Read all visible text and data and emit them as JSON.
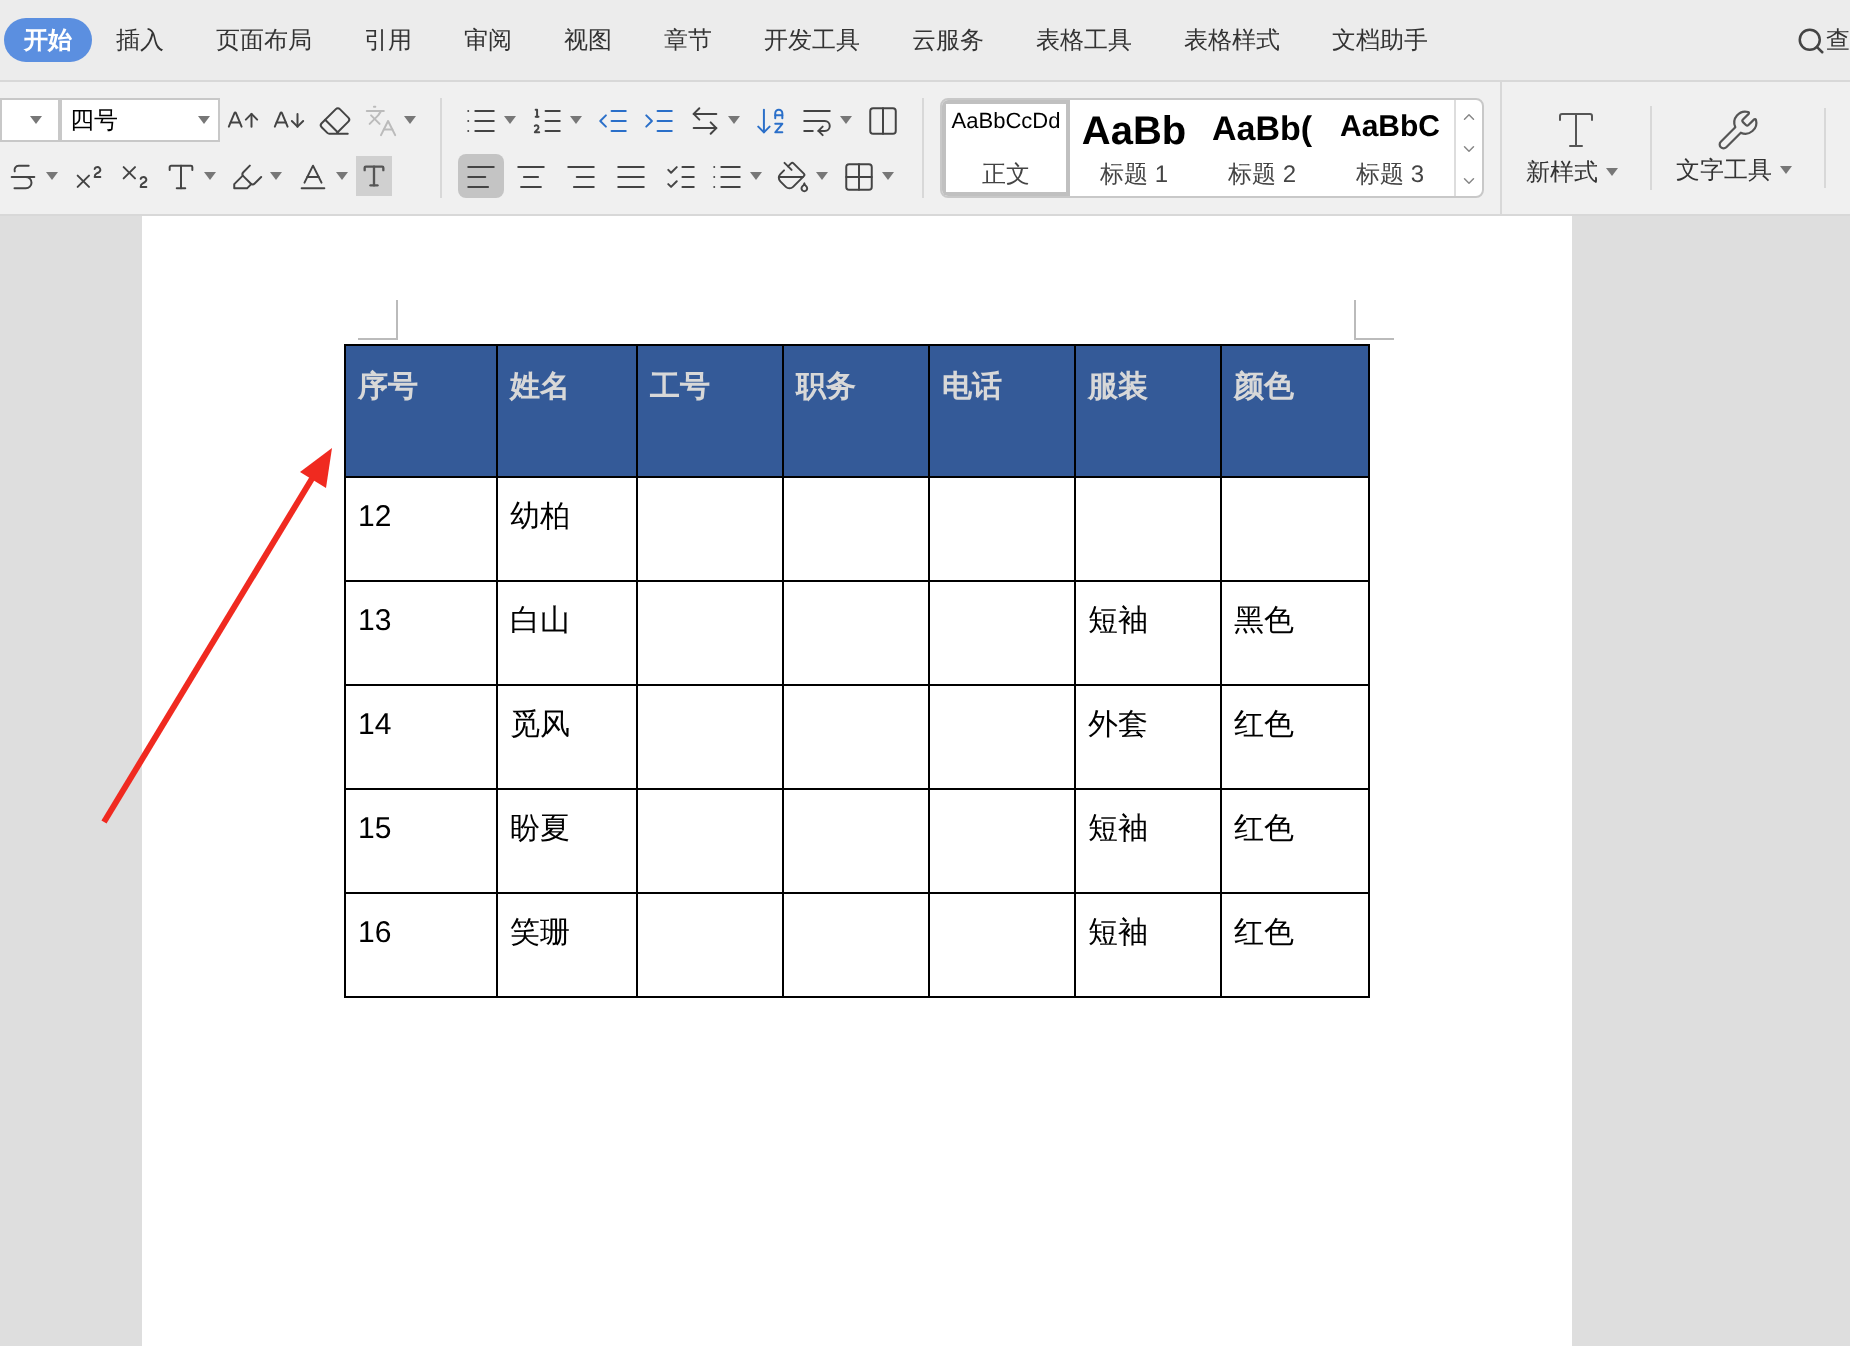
{
  "menu_tabs": [
    {
      "label": "开始",
      "selected": true
    },
    {
      "label": "插入",
      "selected": false
    },
    {
      "label": "页面布局",
      "selected": false
    },
    {
      "label": "引用",
      "selected": false
    },
    {
      "label": "审阅",
      "selected": false
    },
    {
      "label": "视图",
      "selected": false
    },
    {
      "label": "章节",
      "selected": false
    },
    {
      "label": "开发工具",
      "selected": false
    },
    {
      "label": "云服务",
      "selected": false
    },
    {
      "label": "表格工具",
      "selected": false
    },
    {
      "label": "表格样式",
      "selected": false
    },
    {
      "label": "文档助手",
      "selected": false
    }
  ],
  "search_label": "查",
  "font_size": "四号",
  "alignment": [
    {
      "kind": "left",
      "selected": true
    },
    {
      "kind": "center",
      "selected": false
    },
    {
      "kind": "right",
      "selected": false
    },
    {
      "kind": "justify",
      "selected": false
    }
  ],
  "styles": [
    {
      "preview": "AaBbCcDd",
      "label": "正文",
      "kind": "body",
      "selected": true
    },
    {
      "preview": "AaBb",
      "label": "标题 1",
      "kind": "h1",
      "selected": false
    },
    {
      "preview": "AaBb(",
      "label": "标题 2",
      "kind": "h2",
      "selected": false
    },
    {
      "preview": "AaBbC",
      "label": "标题 3",
      "kind": "h3",
      "selected": false
    }
  ],
  "new_style": "新样式",
  "text_tools": "文字工具",
  "table": {
    "columns": [
      "序号",
      "姓名",
      "工号",
      "职务",
      "电话",
      "服装",
      "颜色"
    ],
    "rows": [
      [
        "12",
        "幼柏",
        "",
        "",
        "",
        "",
        ""
      ],
      [
        "13",
        "白山",
        "",
        "",
        "",
        "短袖",
        "黑色"
      ],
      [
        "14",
        "觅风",
        "",
        "",
        "",
        "外套",
        "红色"
      ],
      [
        "15",
        "盼夏",
        "",
        "",
        "",
        "短袖",
        "红色"
      ],
      [
        "16",
        "笑珊",
        "",
        "",
        "",
        "短袖",
        "红色"
      ]
    ]
  }
}
